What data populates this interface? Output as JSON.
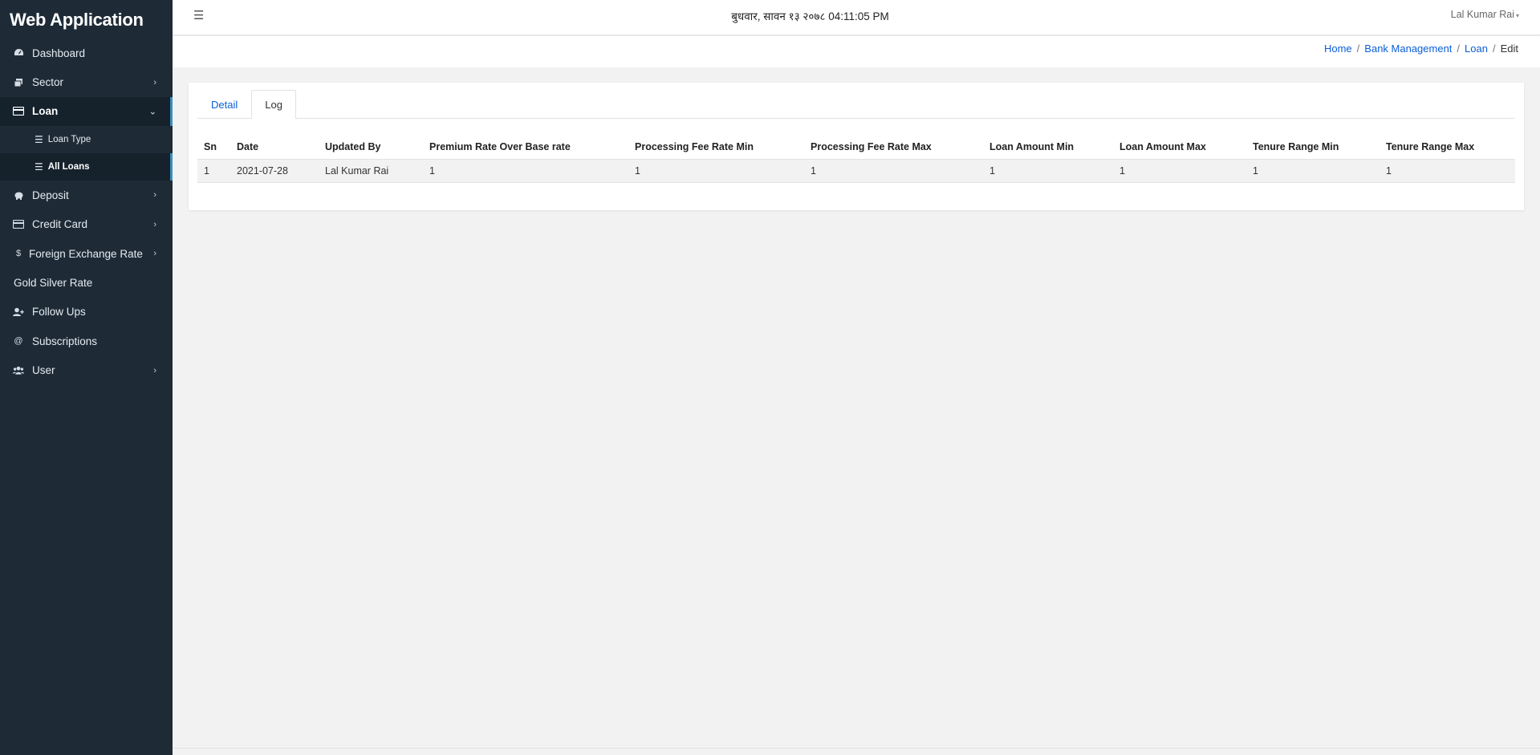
{
  "app": {
    "title": "Web Application"
  },
  "sidebar": {
    "items": [
      {
        "label": "Dashboard",
        "icon": "dashboard-icon"
      },
      {
        "label": "Sector",
        "icon": "sector-icon"
      },
      {
        "label": "Loan",
        "icon": "loan-icon"
      },
      {
        "label": "Deposit",
        "icon": "piggy-bank-icon"
      },
      {
        "label": "Credit Card",
        "icon": "credit-card-icon"
      },
      {
        "label": "Foreign Exchange Rate",
        "icon": "dollar-icon"
      },
      {
        "label": "Gold Silver Rate"
      },
      {
        "label": "Follow Ups",
        "icon": "user-plus-icon"
      },
      {
        "label": "Subscriptions",
        "icon": "at-icon"
      },
      {
        "label": "User",
        "icon": "users-icon"
      }
    ],
    "loan_sub": [
      {
        "label": "Loan Type",
        "icon": "list-icon"
      },
      {
        "label": "All Loans",
        "icon": "list-icon"
      }
    ]
  },
  "header": {
    "datetime": "बुधवार, सावन १३ २०७८ 04:11:05 PM",
    "user": "Lal Kumar Rai"
  },
  "breadcrumb": {
    "home": "Home",
    "bank_management": "Bank Management",
    "loan": "Loan",
    "current": "Edit",
    "separator": "/"
  },
  "tabs": [
    {
      "label": "Detail",
      "active": false
    },
    {
      "label": "Log",
      "active": true
    }
  ],
  "log_table": {
    "headers": [
      "Sn",
      "Date",
      "Updated By",
      "Premium Rate Over Base rate",
      "Processing Fee Rate Min",
      "Processing Fee Rate Max",
      "Loan Amount Min",
      "Loan Amount Max",
      "Tenure Range Min",
      "Tenure Range Max"
    ],
    "rows": [
      [
        "1",
        "2021-07-28",
        "Lal Kumar Rai",
        "1",
        "1",
        "1",
        "1",
        "1",
        "1",
        "1"
      ]
    ]
  },
  "colors": {
    "sidebar_bg": "#1e2b37",
    "sidebar_active_bg": "#15212b",
    "accent": "#3c8dbc",
    "link": "#0b5ed7"
  }
}
